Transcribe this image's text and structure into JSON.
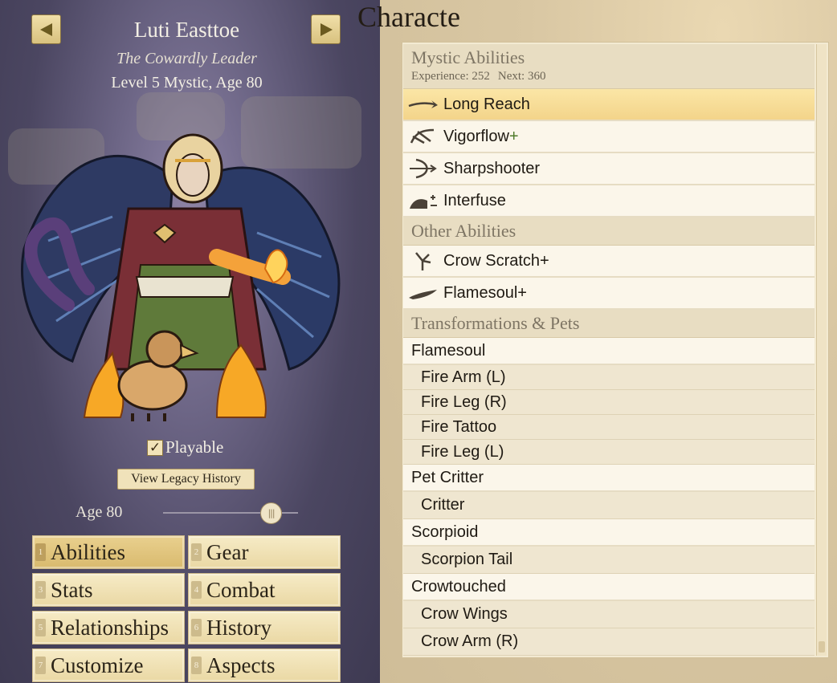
{
  "character": {
    "name": "Luti Easttoe",
    "title": "The Cowardly Leader",
    "level_line": "Level 5 Mystic, Age 80",
    "playable_label": "Playable",
    "playable_checked": true,
    "legacy_button": "View Legacy History",
    "age_label": "Age 80",
    "age_slider_fraction": 0.86
  },
  "nav": {
    "prev_icon": "arrow-left-icon",
    "next_icon": "arrow-right-icon"
  },
  "tabs": [
    {
      "key": "1",
      "label": "Abilities",
      "active": true
    },
    {
      "key": "2",
      "label": "Gear",
      "active": false
    },
    {
      "key": "3",
      "label": "Stats",
      "active": false
    },
    {
      "key": "4",
      "label": "Combat",
      "active": false
    },
    {
      "key": "5",
      "label": "Relationships",
      "active": false
    },
    {
      "key": "6",
      "label": "History",
      "active": false
    },
    {
      "key": "7",
      "label": "Customize",
      "active": false
    },
    {
      "key": "8",
      "label": "Aspects",
      "active": false
    }
  ],
  "page_heading": "Characte",
  "mystic": {
    "title": "Mystic Abilities",
    "experience_label": "Experience: 252",
    "next_label": "Next: 360",
    "abilities": [
      {
        "name": "Long Reach",
        "plus": "",
        "icon": "long-reach-icon",
        "selected": true
      },
      {
        "name": "Vigorflow",
        "plus": "+",
        "icon": "vigorflow-icon",
        "selected": false
      },
      {
        "name": "Sharpshooter",
        "plus": "",
        "icon": "bow-icon",
        "selected": false
      },
      {
        "name": "Interfuse",
        "plus": "",
        "icon": "interfuse-icon",
        "selected": false
      }
    ]
  },
  "other": {
    "title": "Other Abilities",
    "abilities": [
      {
        "name": "Crow Scratch+",
        "icon": "crow-scratch-icon"
      },
      {
        "name": "Flamesoul+",
        "icon": "flamesoul-icon"
      }
    ]
  },
  "transformations": {
    "title": "Transformations & Pets",
    "groups": [
      {
        "name": "Flamesoul",
        "items": [
          "Fire Arm (L)",
          "Fire Leg (R)",
          "Fire Tattoo",
          "Fire Leg (L)"
        ]
      },
      {
        "name": "Pet Critter",
        "items": [
          "Critter"
        ]
      },
      {
        "name": "Scorpioid",
        "items": [
          "Scorpion Tail"
        ]
      },
      {
        "name": "Crowtouched",
        "items": [
          "Crow Wings",
          "Crow Arm (R)"
        ]
      }
    ]
  }
}
